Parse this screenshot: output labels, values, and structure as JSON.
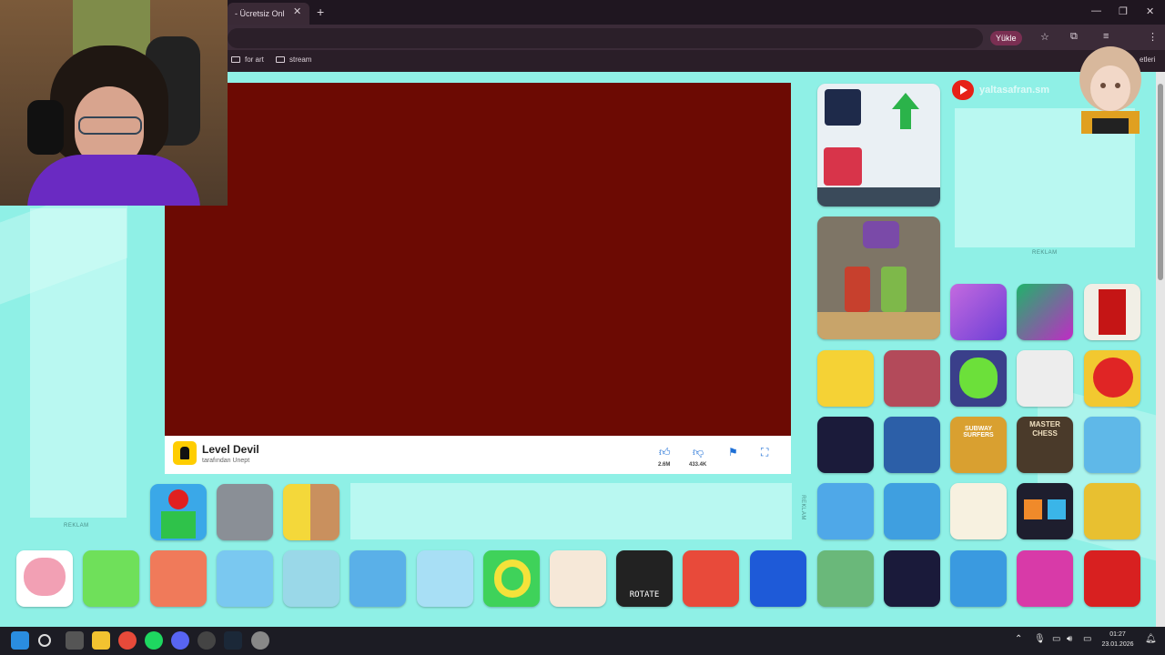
{
  "browser": {
    "tab_title": "- Ücretsiz Onl",
    "tab_close": "✕",
    "new_tab": "+",
    "upload_button": "Yükle",
    "window": {
      "minimize": "—",
      "maximize": "❐",
      "close": "✕"
    }
  },
  "bookmarks": [
    {
      "label": "for art"
    },
    {
      "label": "stream"
    }
  ],
  "bookmark_overflow": "etleri",
  "game": {
    "title": "Level Devil",
    "developer": "tarafından Unept",
    "likes": "2.6M",
    "dislikes": "433.4K"
  },
  "ads": {
    "label": "REKLAM"
  },
  "overlay": {
    "handle": "yaltasafran.sm"
  },
  "tile_texts": {
    "rotate": "ROTATE",
    "master_chess": "MASTER CHESS",
    "subway": "SUBWAY SURFERS"
  },
  "taskbar": {
    "time": "01:27",
    "date": "23.01.2026"
  },
  "colors": {
    "page_bg": "#8ff0e6",
    "game_bg": "#6c0a03",
    "accent_blue": "#1d6fd6"
  }
}
